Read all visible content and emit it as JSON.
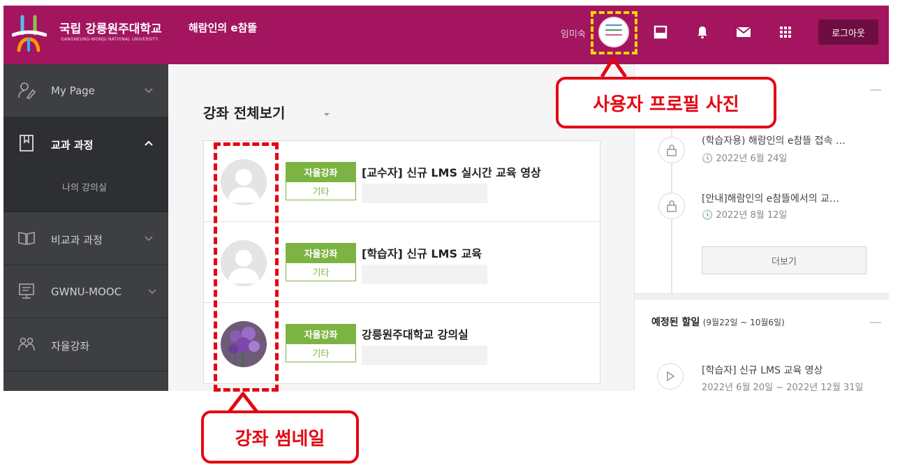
{
  "header": {
    "brand_name": "국립 강릉원주대학교",
    "brand_sub": "GANGNEUNG-WONJU NATIONAL UNIVERSITY",
    "site_title": "해람인의 e참뜰",
    "user_name": "임미숙",
    "logout_label": "로그아웃",
    "icons": [
      "layout-icon",
      "bell-icon",
      "mail-icon",
      "grid-icon"
    ],
    "accent_color": "#a3155f"
  },
  "sidebar": {
    "items": [
      {
        "label": "My Page",
        "icon": "user-edit-icon",
        "expanded": false
      },
      {
        "label": "교과 과정",
        "icon": "book-icon",
        "expanded": true
      },
      {
        "label": "비교과 과정",
        "icon": "open-book-icon",
        "expanded": false
      },
      {
        "label": "GWNU-MOOC",
        "icon": "screen-icon",
        "expanded": false
      },
      {
        "label": "자율강좌",
        "icon": "people-icon",
        "expanded": false
      }
    ],
    "sub_items": [
      {
        "label": "나의 강의실"
      }
    ]
  },
  "main": {
    "title": "강좌 전체보기",
    "courses": [
      {
        "tag": "자율강좌",
        "category": "기타",
        "title": "[교수자] 신규 LMS 실시간 교육 영상",
        "thumb": "placeholder"
      },
      {
        "tag": "자율강좌",
        "category": "기타",
        "title": "[학습자] 신규 LMS 교육",
        "thumb": "placeholder"
      },
      {
        "tag": "자율강좌",
        "category": "기타",
        "title": "강릉원주대학교 강의실",
        "thumb": "flower"
      }
    ],
    "tag_color": "#7cb342"
  },
  "right": {
    "notices": [
      {
        "title": "(학습자용) 해람인의 e참뜰 접속 …",
        "date": "2022년 6월 24일"
      },
      {
        "title": "[안내]해람인의 e참뜰에서의 교…",
        "date": "2022년 8월 12일"
      }
    ],
    "more_label": "더보기",
    "todo_title": "예정된 할일",
    "todo_range": "(9월22일 ~ 10월6일)",
    "todos": [
      {
        "title": "[학습자] 신규 LMS 교육 영상",
        "date": "2022년 6월 20일 ~ 2022년 12월 31일"
      }
    ]
  },
  "annotations": {
    "profile_label": "사용자 프로필 사진",
    "thumbnail_label": "강좌 썸네일",
    "color": "#e30613"
  }
}
